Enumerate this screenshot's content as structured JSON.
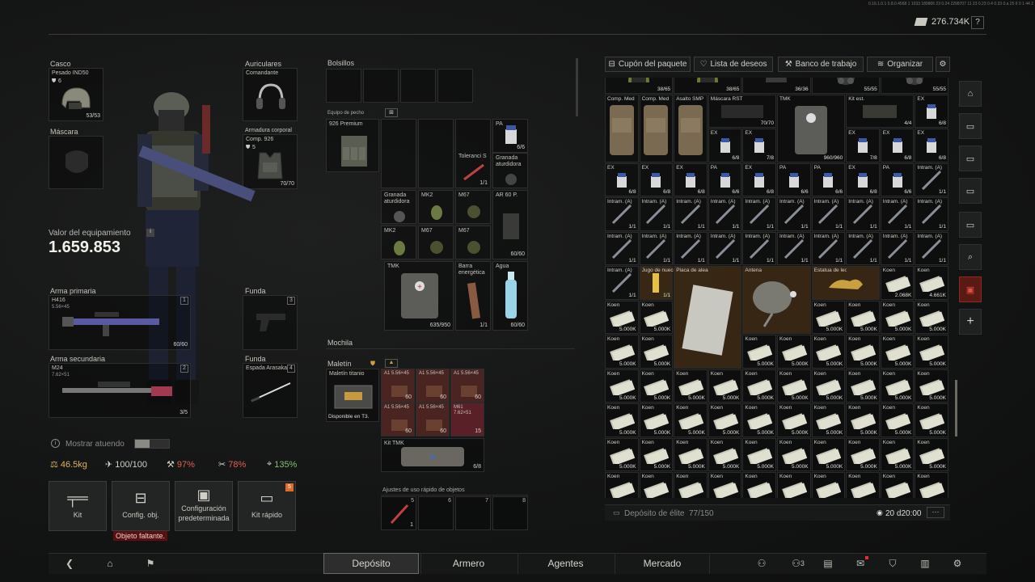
{
  "topbar": {
    "debug_text": "0.16.1.0.1 0.8.0.4568 1 1033 189806 23 0.24 2298707 11 23 0.23 0.4 0.33 0.a 25 6 0 1 44 2",
    "currency": "276.734K",
    "help": "?"
  },
  "equipment": {
    "helmet": {
      "title": "Casco",
      "name": "Pesado IND50",
      "armor": "6",
      "dur": "53/53"
    },
    "mask": {
      "title": "Máscara"
    },
    "earpiece": {
      "title": "Auriculares",
      "name": "Comandante"
    },
    "armor": {
      "title": "Armadura corporal",
      "name": "Comp. 926",
      "armor": "5",
      "dur": "70/70"
    },
    "value_label": "Valor del equipamiento",
    "value": "1.659.853",
    "value_info": "i",
    "primary": {
      "title": "Arma primaria",
      "slot": "1",
      "name": "H416",
      "ammo": "5.56×45",
      "count": "60/60"
    },
    "secondary": {
      "title": "Arma secundaria",
      "slot": "2",
      "name": "M24",
      "ammo": "7.62×51",
      "count": "3/5"
    },
    "holster": {
      "title": "Funda",
      "slot": "3"
    },
    "melee": {
      "title": "Funda",
      "slot": "4",
      "name": "Espada Arasaka"
    },
    "show_outfit": "Mostrar atuendo",
    "stats": [
      {
        "icon": "weight-icon",
        "value": "46.5kg",
        "color": "#e0b060"
      },
      {
        "icon": "stamina-icon",
        "value": "100/100",
        "color": "#d0d0c8"
      },
      {
        "icon": "speed-icon",
        "value": "97%",
        "color": "#e06050"
      },
      {
        "icon": "ergo-icon",
        "value": "78%",
        "color": "#e06050"
      },
      {
        "icon": "aim-icon",
        "value": "135%",
        "color": "#80c070"
      }
    ],
    "quick_buttons": [
      {
        "label": "Kit",
        "icon": "rifle-icon"
      },
      {
        "label": "Config. obj.",
        "icon": "toolbox-icon"
      },
      {
        "label": "Configuración predeterminada",
        "icon": "folder-icon"
      },
      {
        "label": "Kit rápido",
        "icon": "card-icon",
        "badge": "5"
      }
    ],
    "missing": "Objeto faltante."
  },
  "pockets": {
    "title": "Bolsillos",
    "rig_title": "Equipo de pecho",
    "rig_name": "926 Premium",
    "items": [
      {
        "name": "PA",
        "val": "6/6"
      },
      {
        "name": "Toleranci S",
        "val": "1/1"
      },
      {
        "name": "Granada aturdidora",
        "val": ""
      },
      {
        "name": "Granada aturdidora",
        "val": ""
      },
      {
        "name": "MK2",
        "val": ""
      },
      {
        "name": "M67",
        "val": ""
      },
      {
        "name": "AR 60 P.",
        "val": "60/60"
      },
      {
        "name": "MK2",
        "val": ""
      },
      {
        "name": "M67",
        "val": ""
      },
      {
        "name": "M67",
        "val": ""
      },
      {
        "name": "TMK",
        "val": "635/950"
      },
      {
        "name": "Barra energética",
        "val": "1/1"
      },
      {
        "name": "Agua",
        "val": "60/60"
      }
    ],
    "backpack_title": "Mochila",
    "case_title": "Maletín",
    "case_name": "Maletín titanio",
    "case_note": "Disponible en T3.",
    "case_items": [
      {
        "name": "A1 5.56×45",
        "val": "60"
      },
      {
        "name": "A1 5.56×45",
        "val": "60"
      },
      {
        "name": "A1 5.56×45",
        "val": "60"
      },
      {
        "name": "A1 5.56×45",
        "val": "60"
      },
      {
        "name": "A1 5.56×45",
        "val": "60"
      },
      {
        "name": "M61 7.62×51",
        "val": "15"
      }
    ],
    "case_kit": {
      "name": "Kit TMK",
      "val": "6/8"
    },
    "quick_title": "Ajustes de uso rápido de objetos",
    "quick_slots": [
      "5",
      "6",
      "7",
      "8"
    ],
    "quick_count": "1"
  },
  "stash": {
    "toolbar": [
      "Cupón del paquete",
      "Lista de deseos",
      "Banco de trabajo",
      "Organizar"
    ],
    "footer_label": "Depósito de élite",
    "footer_count": "77/150",
    "footer_time": "20 d20:00",
    "footer_more": "···",
    "row0": [
      "38/65",
      "38/65",
      "36/36",
      "55/55",
      "55/55"
    ],
    "row1": [
      {
        "name": "Comp. Med",
        "val": ""
      },
      {
        "name": "Comp. Med",
        "val": ""
      },
      {
        "name": "Asalto SMP",
        "val": ""
      },
      {
        "name": "Máscara RST",
        "val": "70/70"
      },
      {
        "name": "TMK",
        "val": "960/960"
      },
      {
        "name": "Kit est.",
        "val": "4/4"
      },
      {
        "name": "EX",
        "val": "6/8"
      }
    ],
    "exrow": [
      {
        "name": "EX",
        "val": "6/8"
      },
      {
        "name": "EX",
        "val": "7/8"
      },
      {
        "name": "EX",
        "val": "7/8"
      },
      {
        "name": "EX",
        "val": "6/8"
      },
      {
        "name": "EX",
        "val": "6/8"
      }
    ],
    "row3": [
      {
        "name": "EX",
        "val": "6/8"
      },
      {
        "name": "EX",
        "val": "6/8"
      },
      {
        "name": "EX",
        "val": "6/8"
      },
      {
        "name": "PA",
        "val": "6/6"
      },
      {
        "name": "EX",
        "val": "6/8"
      },
      {
        "name": "PA",
        "val": "6/6"
      },
      {
        "name": "PA",
        "val": "6/6"
      },
      {
        "name": "EX",
        "val": "6/8"
      },
      {
        "name": "PA",
        "val": "6/6"
      },
      {
        "name": "Intram. (A)",
        "val": "1/1"
      }
    ],
    "inj_name": "Intram. (A)",
    "inj_val": "1/1",
    "row6": [
      {
        "name": "Intram. (A)",
        "val": "1/1"
      },
      {
        "name": "Jugo de nueces",
        "val": "1/1"
      }
    ],
    "plate": {
      "name": "Placa de aleación de titanio"
    },
    "antenna": {
      "name": "Antena"
    },
    "leopard": {
      "name": "Estatua de leopardo de oro"
    },
    "koen_name": "Koen",
    "koen_top": [
      "2.068K",
      "4.661K"
    ],
    "koen_val": "5.000K"
  },
  "nav": {
    "tabs": [
      "Depósito",
      "Armero",
      "Agentes",
      "Mercado"
    ],
    "active": "Depósito",
    "friends_count": "3"
  }
}
